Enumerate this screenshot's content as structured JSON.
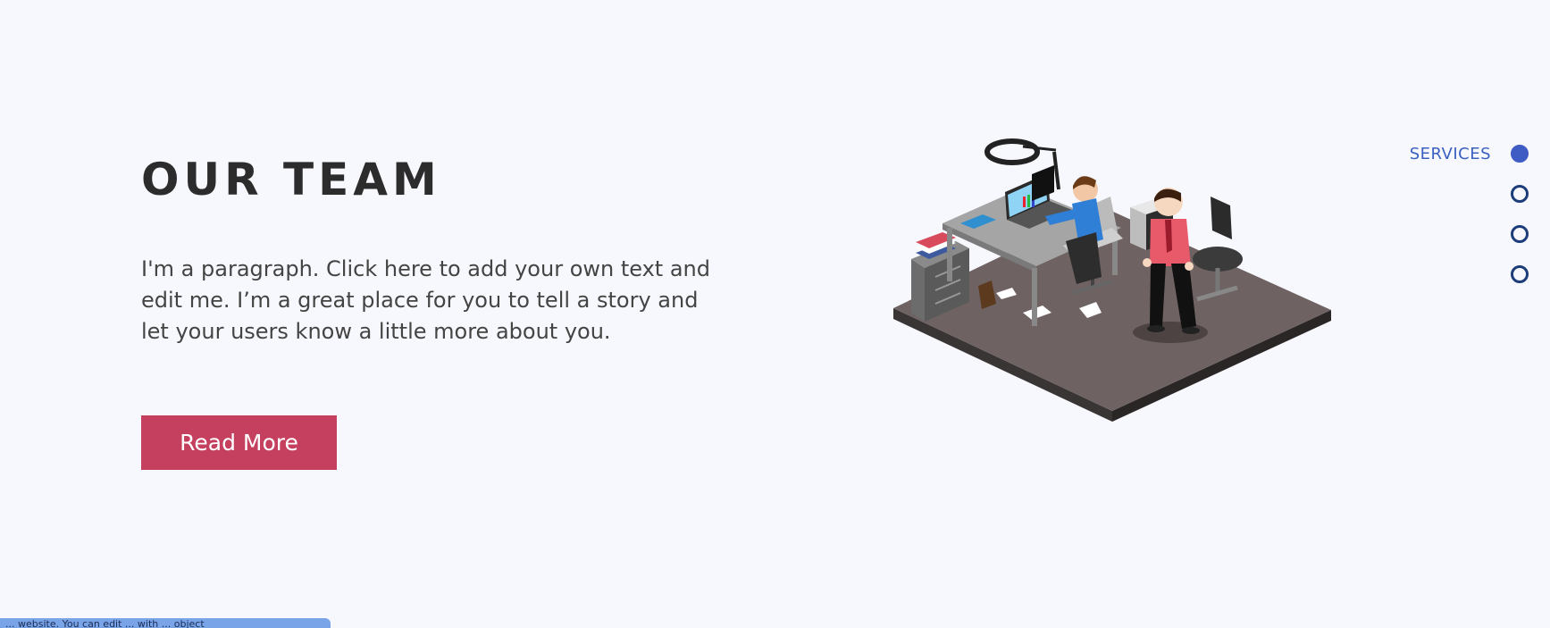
{
  "hero": {
    "title": "OUR TEAM",
    "paragraph": "I'm a paragraph. Click here to add your own text and edit me. I’m a great place for you to tell a story and let your users know a little more about you.",
    "button_label": "Read More"
  },
  "side_nav": {
    "items": [
      {
        "label": "SERVICES",
        "active": true
      },
      {
        "label": "",
        "active": false
      },
      {
        "label": "",
        "active": false
      },
      {
        "label": "",
        "active": false
      }
    ]
  },
  "colors": {
    "background": "#f7f8fd",
    "button": "#c4405e",
    "nav_active": "#3f5bc4",
    "nav_inactive": "#1d3d7a",
    "floor": "#6e6262"
  },
  "status_bar": {
    "text": "... website. You can edit ... with ... object"
  }
}
